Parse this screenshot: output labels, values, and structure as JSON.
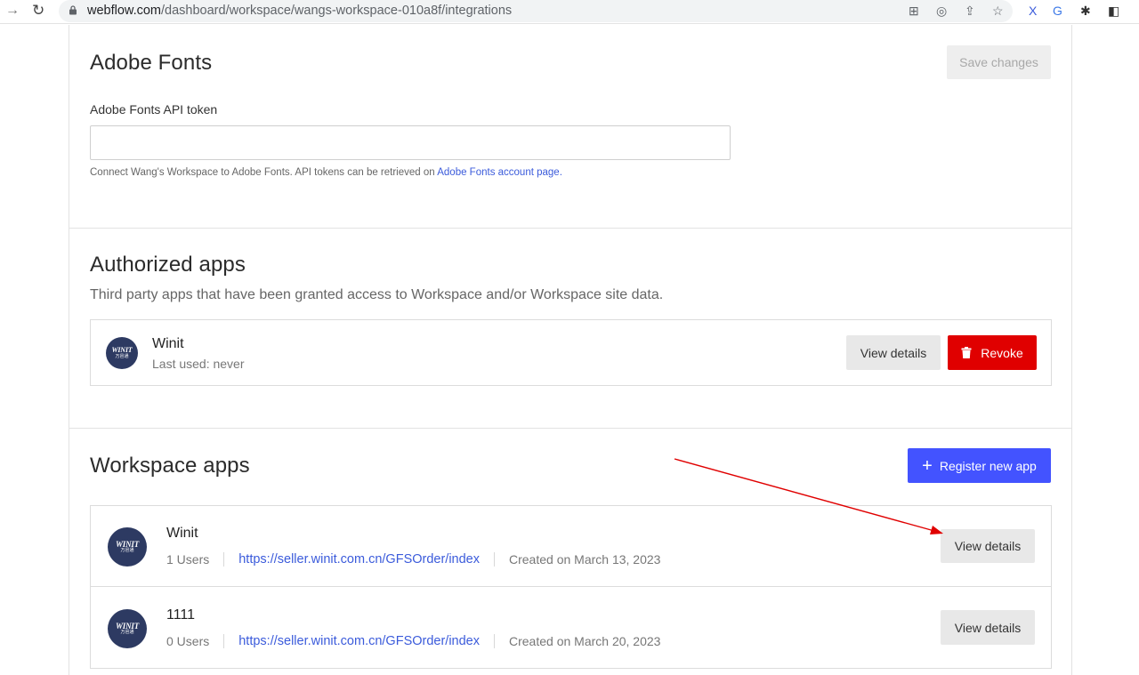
{
  "browser": {
    "url_host": "webflow.com",
    "url_path": "/dashboard/workspace/wangs-workspace-010a8f/integrations"
  },
  "adobe_fonts": {
    "title": "Adobe Fonts",
    "save_label": "Save changes",
    "token_label": "Adobe Fonts API token",
    "token_value": "",
    "help_text": "Connect Wang's Workspace to Adobe Fonts. API tokens can be retrieved on ",
    "help_link": "Adobe Fonts account page."
  },
  "authorized_apps": {
    "title": "Authorized apps",
    "subtitle": "Third party apps that have been granted access to Workspace and/or Workspace site data.",
    "items": [
      {
        "name": "Winit",
        "last_used": "Last used: never",
        "view_label": "View details",
        "revoke_label": "Revoke"
      }
    ]
  },
  "workspace_apps": {
    "title": "Workspace apps",
    "register_label": "Register new app",
    "items": [
      {
        "name": "Winit",
        "users": "1 Users",
        "url": "https://seller.winit.com.cn/GFSOrder/index",
        "created": "Created on March 13, 2023",
        "view_label": "View details"
      },
      {
        "name": "1111",
        "users": "0 Users",
        "url": "https://seller.winit.com.cn/GFSOrder/index",
        "created": "Created on March 20, 2023",
        "view_label": "View details"
      }
    ]
  },
  "logo": {
    "text": "WINIT",
    "sub": "万邑通"
  },
  "colors": {
    "primary": "#4353ff",
    "danger": "#e00000",
    "link": "#3b5bdb",
    "annotation_arrow": "#e00000"
  }
}
